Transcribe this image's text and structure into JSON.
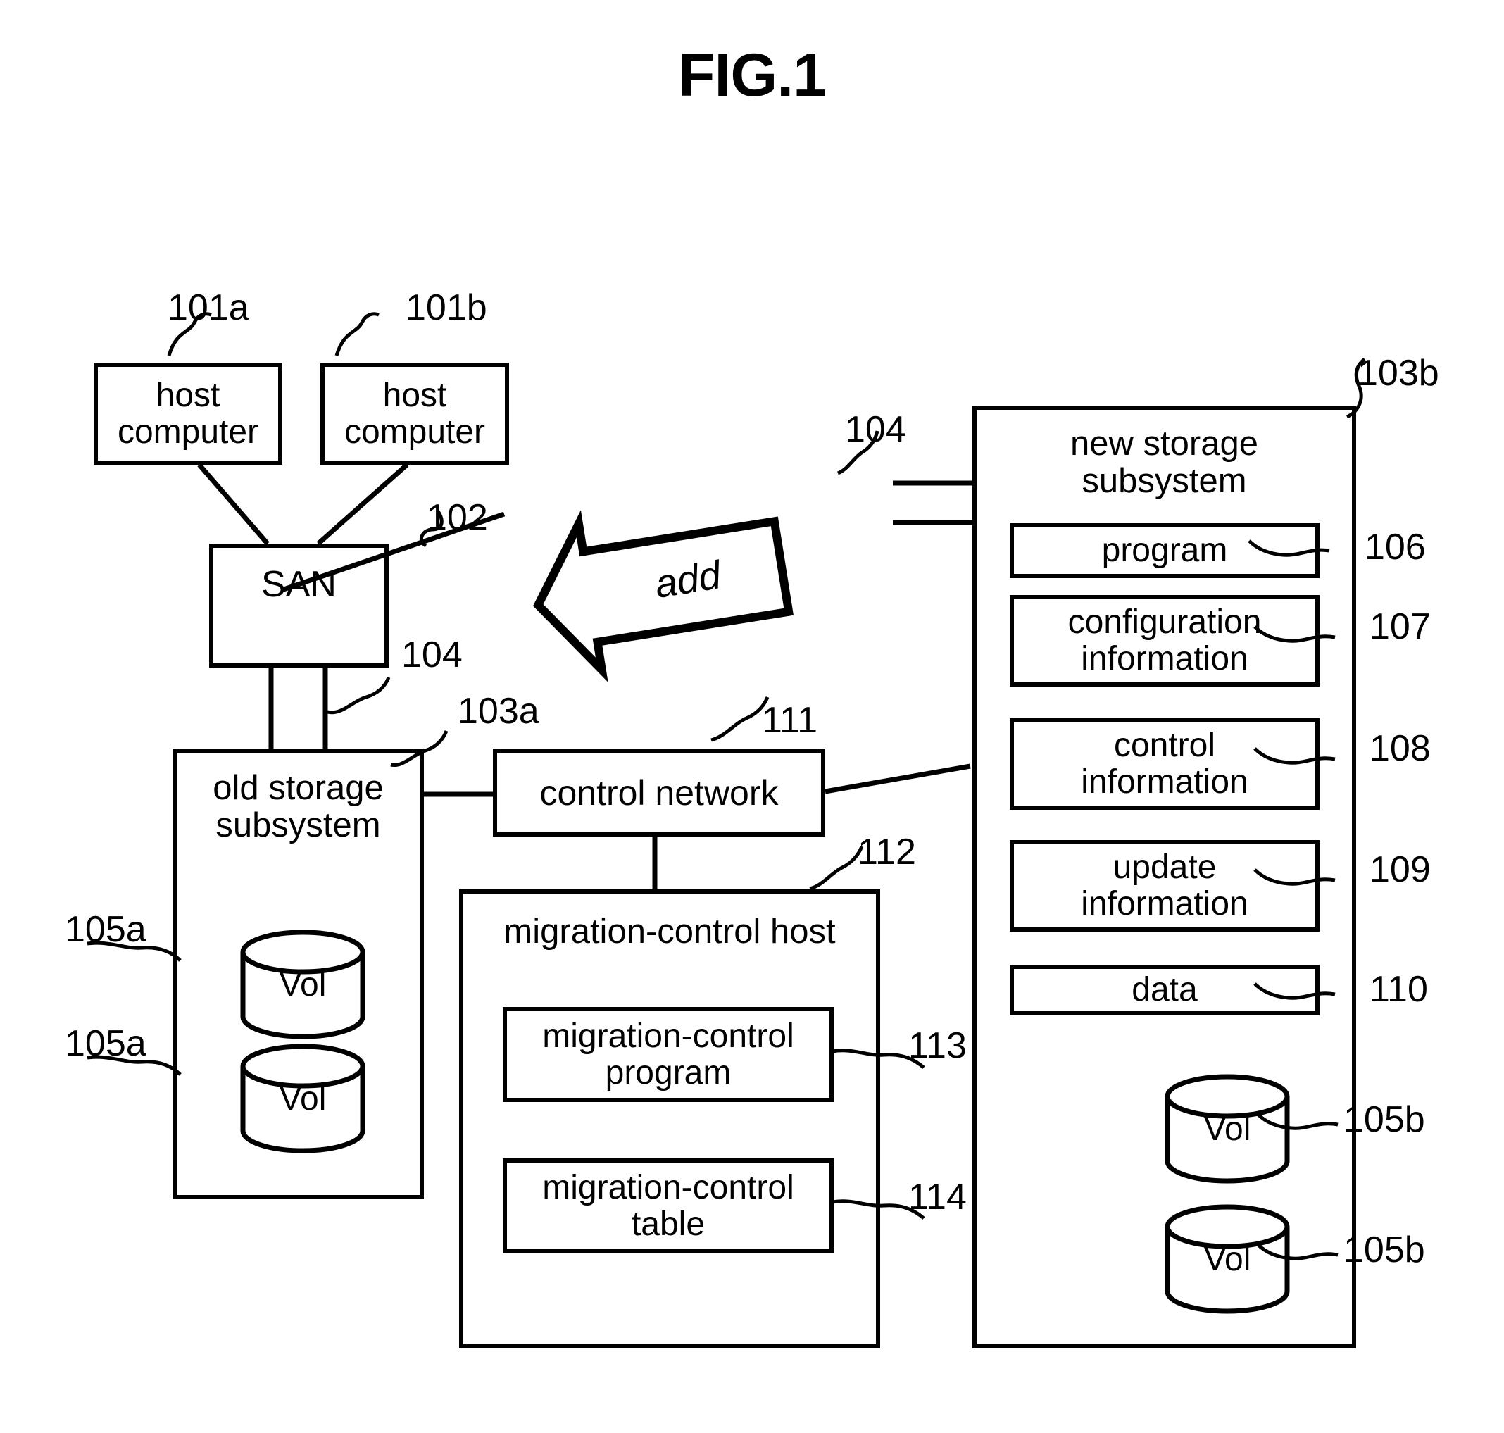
{
  "figure": {
    "title": "FIG.1"
  },
  "nodes": {
    "host_a": {
      "label_line1": "host",
      "label_line2": "computer",
      "ref": "101a"
    },
    "host_b": {
      "label_line1": "host",
      "label_line2": "computer",
      "ref": "101b"
    },
    "san": {
      "label": "SAN",
      "ref": "102"
    },
    "old_storage": {
      "label_line1": "old storage",
      "label_line2": "subsystem",
      "ref": "103a"
    },
    "new_storage": {
      "label_line1": "new storage",
      "label_line2": "subsystem",
      "ref": "103b"
    },
    "control_network": {
      "label": "control network",
      "ref": "111"
    },
    "migration_host": {
      "label": "migration-control host",
      "ref": "112"
    },
    "add_arrow": {
      "label": "add"
    }
  },
  "links": {
    "san_to_old_ref": "104",
    "san_to_new_ref": "104"
  },
  "new_storage_items": [
    {
      "label_line1": "program",
      "label_line2": "",
      "ref": "106"
    },
    {
      "label_line1": "configuration",
      "label_line2": "information",
      "ref": "107"
    },
    {
      "label_line1": "control",
      "label_line2": "information",
      "ref": "108"
    },
    {
      "label_line1": "update",
      "label_line2": "information",
      "ref": "109"
    },
    {
      "label_line1": "data",
      "label_line2": "",
      "ref": "110"
    }
  ],
  "migration_host_items": [
    {
      "label_line1": "migration-control",
      "label_line2": "program",
      "ref": "113"
    },
    {
      "label_line1": "migration-control",
      "label_line2": "table",
      "ref": "114"
    }
  ],
  "old_storage_volumes": [
    {
      "label": "Vol",
      "ref": "105a"
    },
    {
      "label": "Vol",
      "ref": "105a"
    }
  ],
  "new_storage_volumes": [
    {
      "label": "Vol",
      "ref": "105b"
    },
    {
      "label": "Vol",
      "ref": "105b"
    }
  ],
  "colors": {
    "ink": "#000000",
    "paper": "#ffffff"
  }
}
